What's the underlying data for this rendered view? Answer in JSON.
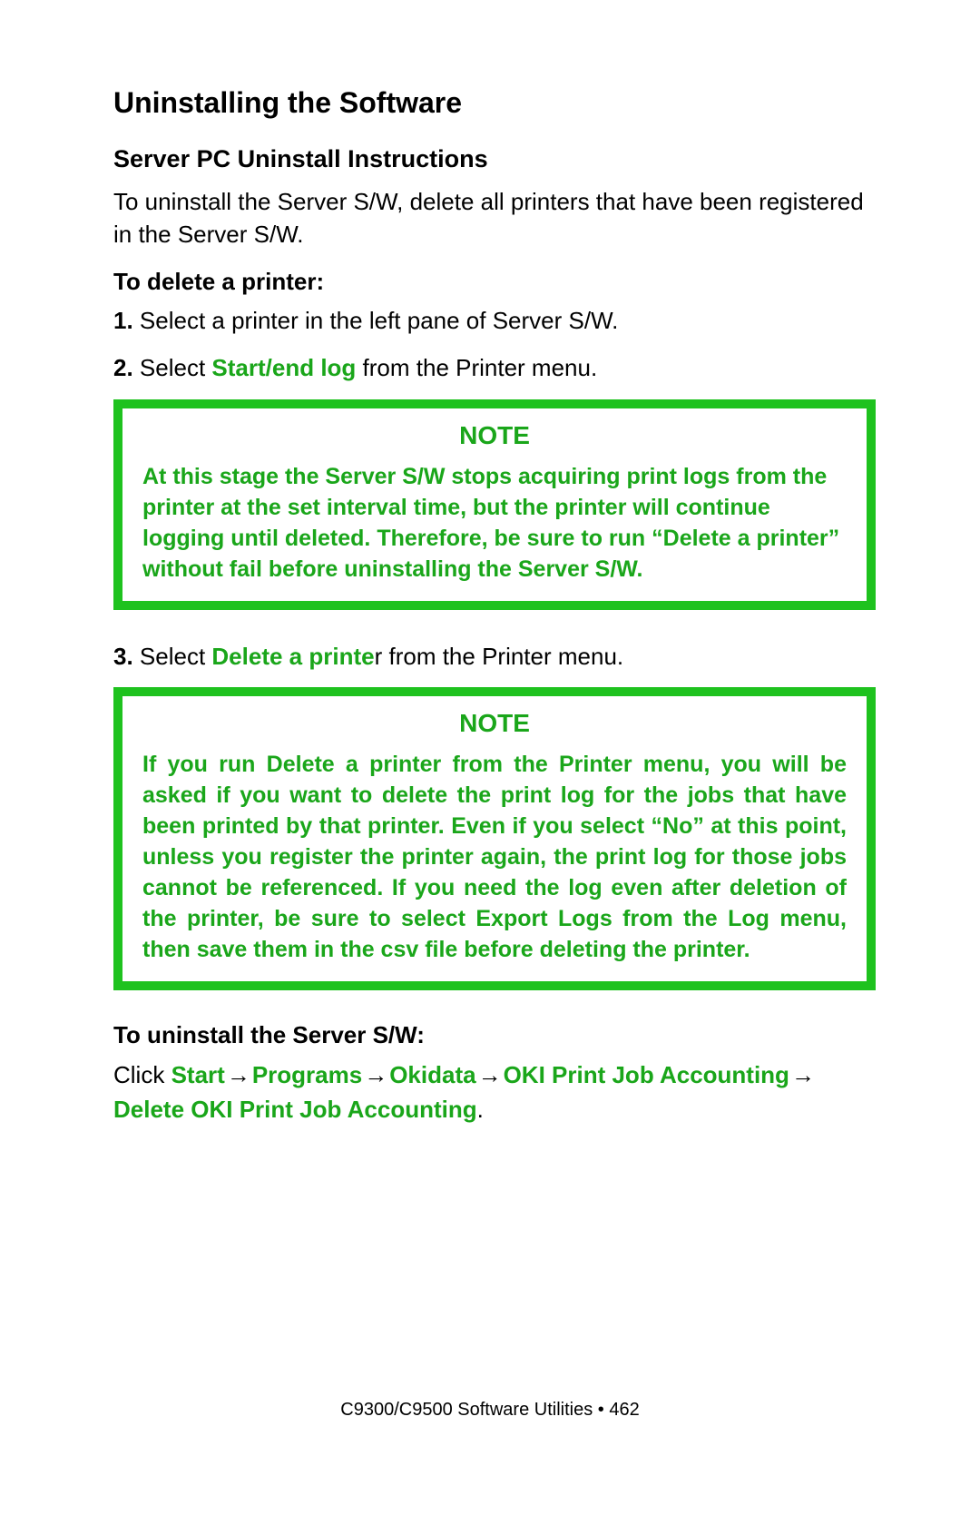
{
  "title": "Uninstalling the Software",
  "subtitle": "Server PC Uninstall Instructions",
  "intro": "To uninstall the Server S/W, delete all printers that have been registered in the Server S/W.",
  "delete_heading": "To delete a printer:",
  "steps": {
    "n1": "1.",
    "s1": " Select a printer in the left pane of Server S/W.",
    "n2": "2.",
    "s2a": " Select ",
    "s2b_green": "Start/end log",
    "s2c": " from the Printer menu.",
    "n3": "3.",
    "s3a": " Select ",
    "s3b_green": "Delete a printe",
    "s3c_black": "r",
    "s3d": " from the Printer menu."
  },
  "note_label": "NOTE",
  "note1": "At this stage the Server S/W stops acquiring print logs from the printer at the set interval time, but the printer will continue logging until deleted. Therefore, be sure to run “Delete a printer” without fail before uninstalling the Server S/W.",
  "note2": "If you run Delete a printer from the Printer menu, you will be asked if you want to delete the print log for the jobs that have been printed by that printer. Even if you select “No” at this point, unless you register the printer again, the print log for those jobs cannot be referenced. If you need the log even after deletion of the printer, be sure to select Export Logs from the Log menu, then save them in the csv file before deleting the printer.",
  "uninstall_heading": "To uninstall the Server S/W:",
  "path": {
    "click": "Click ",
    "p1": "Start",
    "arrow": " → ",
    "p2": "Programs",
    "p3": "Okidata",
    "p4": "OKI Print Job Accounting",
    "p5": "Delete OKI Print Job Accounting",
    "dot": "."
  },
  "footer": "C9300/C9500 Software Utilities  •  462"
}
